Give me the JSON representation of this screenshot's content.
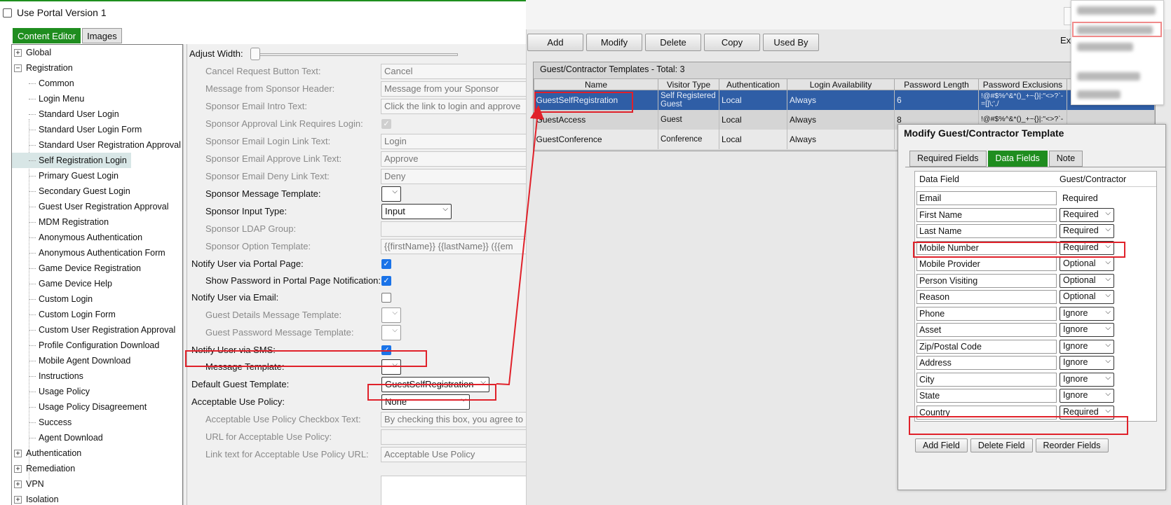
{
  "portal": {
    "use_version_label": "Use Portal Version 1"
  },
  "left_tabs": [
    "Content Editor",
    "Images"
  ],
  "tree": [
    {
      "label": "Global",
      "type": "top",
      "expander": "+"
    },
    {
      "label": "Registration",
      "type": "top",
      "expander": "−"
    },
    {
      "label": "Common",
      "type": "child"
    },
    {
      "label": "Login Menu",
      "type": "child"
    },
    {
      "label": "Standard User Login",
      "type": "child"
    },
    {
      "label": "Standard User Login Form",
      "type": "child"
    },
    {
      "label": "Standard User Registration Approval",
      "type": "child"
    },
    {
      "label": "Self Registration Login",
      "type": "child",
      "selected": true
    },
    {
      "label": "Primary Guest Login",
      "type": "child"
    },
    {
      "label": "Secondary Guest Login",
      "type": "child"
    },
    {
      "label": "Guest User Registration Approval",
      "type": "child"
    },
    {
      "label": "MDM Registration",
      "type": "child"
    },
    {
      "label": "Anonymous Authentication",
      "type": "child"
    },
    {
      "label": "Anonymous Authentication Form",
      "type": "child"
    },
    {
      "label": "Game Device Registration",
      "type": "child"
    },
    {
      "label": "Game Device Help",
      "type": "child"
    },
    {
      "label": "Custom Login",
      "type": "child"
    },
    {
      "label": "Custom Login Form",
      "type": "child"
    },
    {
      "label": "Custom User Registration Approval",
      "type": "child"
    },
    {
      "label": "Profile Configuration Download",
      "type": "child"
    },
    {
      "label": "Mobile Agent Download",
      "type": "child"
    },
    {
      "label": "Instructions",
      "type": "child"
    },
    {
      "label": "Usage Policy",
      "type": "child"
    },
    {
      "label": "Usage Policy Disagreement",
      "type": "child"
    },
    {
      "label": "Success",
      "type": "child"
    },
    {
      "label": "Agent Download",
      "type": "child"
    },
    {
      "label": "Authentication",
      "type": "top",
      "expander": "+"
    },
    {
      "label": "Remediation",
      "type": "top",
      "expander": "+"
    },
    {
      "label": "VPN",
      "type": "top",
      "expander": "+"
    },
    {
      "label": "Isolation",
      "type": "top",
      "expander": "+"
    }
  ],
  "settings": {
    "adjust_width": "Adjust Width:",
    "cancel_btn_label": "Cancel Request Button Text:",
    "cancel_btn_value": "Cancel",
    "msg_header_label": "Message from Sponsor Header:",
    "msg_header_value": "Message from your Sponsor",
    "intro_label": "Sponsor Email Intro Text:",
    "intro_value": "Click the link to login and approve",
    "approval_req_label": "Sponsor Approval Link Requires Login:",
    "login_link_label": "Sponsor Email Login Link Text:",
    "login_link_value": "Login",
    "approve_link_label": "Sponsor Email Approve Link Text:",
    "approve_link_value": "Approve",
    "deny_link_label": "Sponsor Email Deny Link Text:",
    "deny_link_value": "Deny",
    "msg_template_label": "Sponsor Message Template:",
    "input_type_label": "Sponsor Input Type:",
    "input_type_value": "Input",
    "ldap_label": "Sponsor LDAP Group:",
    "option_tmpl_label": "Sponsor Option Template:",
    "option_tmpl_value": "{{firstName}} {{lastName}} ({{em",
    "notify_portal_label": "Notify User via Portal Page:",
    "show_pw_label": "Show Password in Portal Page Notification:",
    "notify_email_label": "Notify User via Email:",
    "guest_details_label": "Guest Details Message Template:",
    "guest_pw_label": "Guest Password Message Template:",
    "notify_sms_label": "Notify User via SMS:",
    "message_tmpl_label": "Message Template:",
    "default_guest_label": "Default Guest Template:",
    "default_guest_value": "GuestSelfRegistration",
    "aup_label": "Acceptable Use Policy:",
    "aup_value": "None",
    "aup_cb_text_label": "Acceptable Use Policy Checkbox Text:",
    "aup_cb_text_value": "By checking this box, you agree to",
    "aup_url_label": "URL for Acceptable Use Policy:",
    "aup_link_label": "Link text for Acceptable Use Policy URL:",
    "aup_link_value": "Acceptable Use Policy"
  },
  "toolbar": {
    "add": "Add",
    "modify": "Modify",
    "delete": "Delete",
    "copy": "Copy",
    "used_by": "Used By",
    "ex": "Ex"
  },
  "templates": {
    "title": "Guest/Contractor Templates - Total: 3",
    "columns": [
      "Name",
      "Visitor Type",
      "Authentication",
      "Login Availability",
      "Password Length",
      "Password Exclusions"
    ],
    "rows": [
      [
        "GuestSelfRegistration",
        "Self Registered Guest",
        "Local",
        "Always",
        "6",
        "!@#$%^&*()_+~{}|:\"<>?`-=[]\\;',/"
      ],
      [
        "GuestAccess",
        "Guest",
        "Local",
        "Always",
        "8",
        "!@#$%^&*()_+~{}|:\"<>?`-"
      ],
      [
        "GuestConference",
        "Conference",
        "Local",
        "Always",
        "",
        ""
      ]
    ]
  },
  "dialog": {
    "title": "Modify Guest/Contractor Template",
    "tabs": [
      "Required Fields",
      "Data Fields",
      "Note"
    ],
    "col_field": "Data Field",
    "col_guest": "Guest/Contractor",
    "fields": [
      {
        "name": "Email",
        "value": "Required",
        "static": true
      },
      {
        "name": "First Name",
        "value": "Required"
      },
      {
        "name": "Last Name",
        "value": "Required"
      },
      {
        "name": "Mobile Number",
        "value": "Required"
      },
      {
        "name": "Mobile Provider",
        "value": "Optional"
      },
      {
        "name": "Person Visiting",
        "value": "Optional"
      },
      {
        "name": "Reason",
        "value": "Optional"
      },
      {
        "name": "Phone",
        "value": "Ignore"
      },
      {
        "name": "Asset",
        "value": "Ignore"
      },
      {
        "name": "Zip/Postal Code",
        "value": "Ignore"
      },
      {
        "name": "Address",
        "value": "Ignore"
      },
      {
        "name": "City",
        "value": "Ignore"
      },
      {
        "name": "State",
        "value": "Ignore"
      },
      {
        "name": "Country",
        "value": "Required"
      }
    ],
    "buttons": {
      "add": "Add Field",
      "delete": "Delete Field",
      "reorder": "Reorder Fields"
    }
  },
  "colors": {
    "accent_green": "#1f8d1f",
    "selected_row": "#2f5ea6",
    "annotation_red": "#e0212a",
    "checkbox_blue": "#1a73e8"
  }
}
